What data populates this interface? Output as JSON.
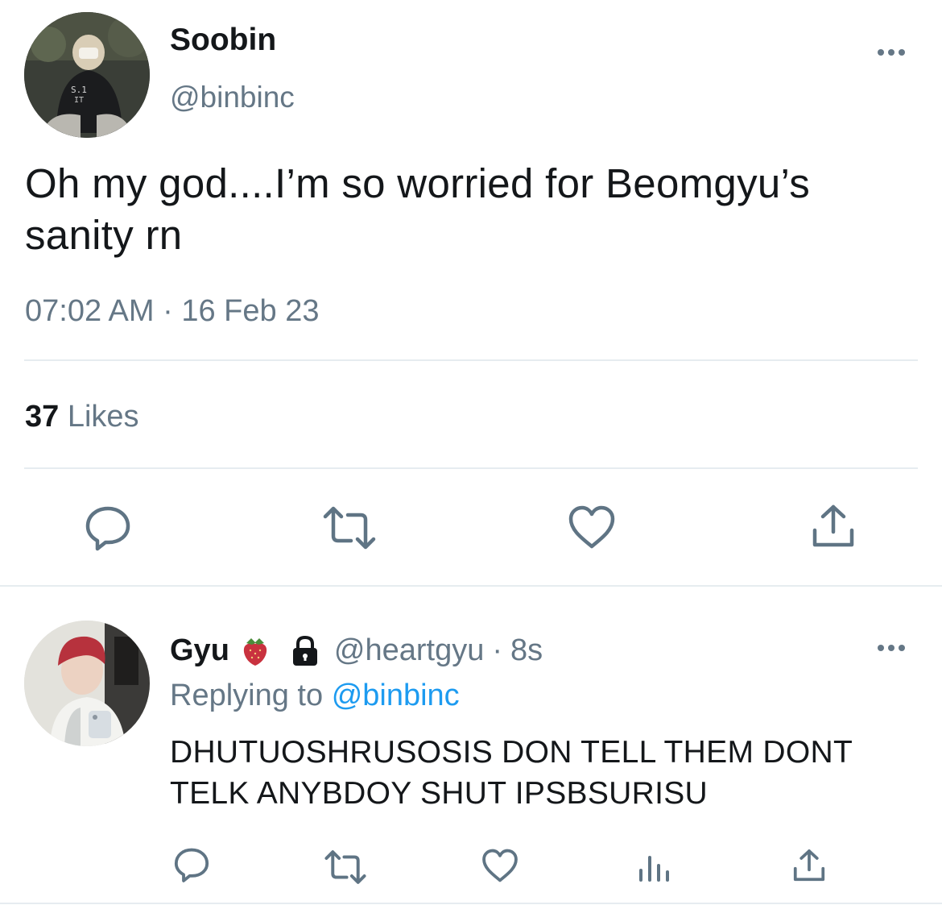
{
  "main_tweet": {
    "display_name": "Soobin",
    "handle": "@binbinc",
    "avatar_label": "S.1\nIT",
    "text_line1": "Oh my god....I’m so worried for Beomgyu’s",
    "text_line2": "sanity rn",
    "timestamp": "07:02 AM",
    "separator": "·",
    "date": "16 Feb 23",
    "likes_count": "37",
    "likes_label": "Likes"
  },
  "reply_tweet": {
    "display_name": "Gyu",
    "emoji": "🍓",
    "handle": "@heartgyu",
    "separator": "·",
    "time_ago": "8s",
    "replying_prefix": "Replying to",
    "replying_handle": "@binbinc",
    "text_line1": "DHUTUOSHRUSOSIS DON TELL THEM DONT",
    "text_line2": "TELK ANYBDOY SHUT IPSBSURISU"
  },
  "icons": {
    "reply": "comment-icon",
    "retweet": "retweet-icon",
    "like": "heart-icon",
    "share": "share-icon",
    "views": "analytics-icon",
    "lock": "lock-icon",
    "more": "more-icon"
  },
  "colors": {
    "accent": "#1d9bf0",
    "secondary_text": "#657786",
    "divider": "#e6ecf0",
    "icon": "#5f7484"
  }
}
